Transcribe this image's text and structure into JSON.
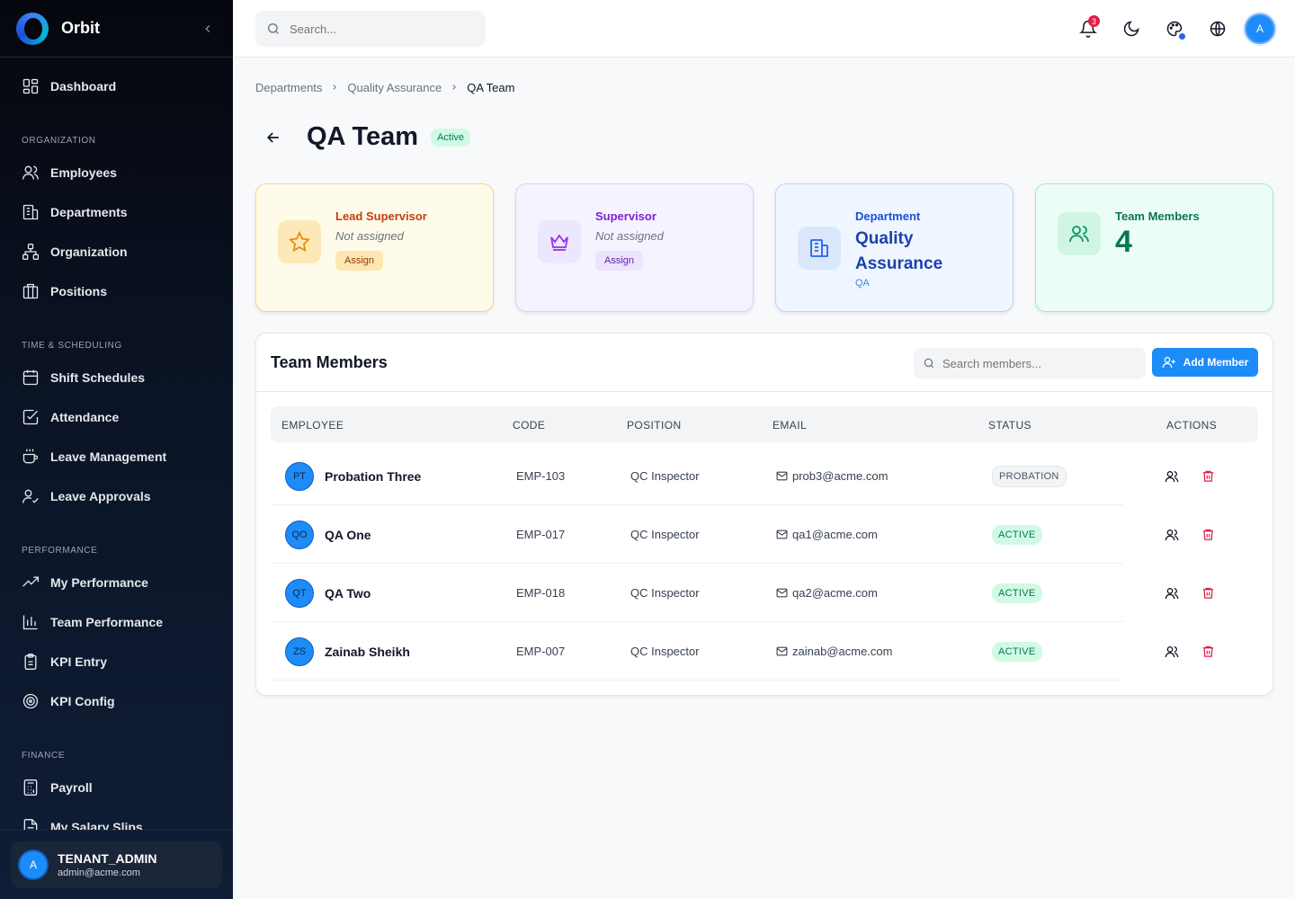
{
  "app": {
    "name": "Orbit"
  },
  "sidebar": {
    "dashboard": "Dashboard",
    "sections": {
      "organization": "ORGANIZATION",
      "time": "TIME & SCHEDULING",
      "performance": "PERFORMANCE",
      "finance": "FINANCE"
    },
    "items": {
      "employees": "Employees",
      "departments": "Departments",
      "organization": "Organization",
      "positions": "Positions",
      "shift_schedules": "Shift Schedules",
      "attendance": "Attendance",
      "leave_management": "Leave Management",
      "leave_approvals": "Leave Approvals",
      "my_performance": "My Performance",
      "team_performance": "Team Performance",
      "kpi_entry": "KPI Entry",
      "kpi_config": "KPI Config",
      "payroll": "Payroll",
      "my_salary_slips": "My Salary Slips"
    },
    "user": {
      "initial": "A",
      "name": "TENANT_ADMIN",
      "email": "admin@acme.com"
    }
  },
  "topbar": {
    "search_placeholder": "Search...",
    "notification_count": "3",
    "avatar_initial": "A"
  },
  "breadcrumb": [
    "Departments",
    "Quality Assurance",
    "QA Team"
  ],
  "page": {
    "title": "QA Team",
    "status": "Active"
  },
  "cards": {
    "lead_supervisor": {
      "label": "Lead Supervisor",
      "value": "Not assigned",
      "action": "Assign"
    },
    "supervisor": {
      "label": "Supervisor",
      "value": "Not assigned",
      "action": "Assign"
    },
    "department": {
      "label": "Department",
      "name": "Quality Assurance",
      "code": "QA"
    },
    "team_members": {
      "label": "Team Members",
      "count": "4"
    }
  },
  "members_panel": {
    "title": "Team Members",
    "search_placeholder": "Search members...",
    "add_label": "Add Member",
    "columns": [
      "EMPLOYEE",
      "CODE",
      "POSITION",
      "EMAIL",
      "STATUS",
      "ACTIONS"
    ],
    "rows": [
      {
        "initials": "PT",
        "name": "Probation Three",
        "code": "EMP-103",
        "position": "QC Inspector",
        "email": "prob3@acme.com",
        "status": "PROBATION"
      },
      {
        "initials": "QO",
        "name": "QA One",
        "code": "EMP-017",
        "position": "QC Inspector",
        "email": "qa1@acme.com",
        "status": "ACTIVE"
      },
      {
        "initials": "QT",
        "name": "QA Two",
        "code": "EMP-018",
        "position": "QC Inspector",
        "email": "qa2@acme.com",
        "status": "ACTIVE"
      },
      {
        "initials": "ZS",
        "name": "Zainab Sheikh",
        "code": "EMP-007",
        "position": "QC Inspector",
        "email": "zainab@acme.com",
        "status": "ACTIVE"
      }
    ]
  },
  "colors": {
    "accent": "#1d8cf8",
    "danger": "#e11d48",
    "success": "#047857"
  }
}
